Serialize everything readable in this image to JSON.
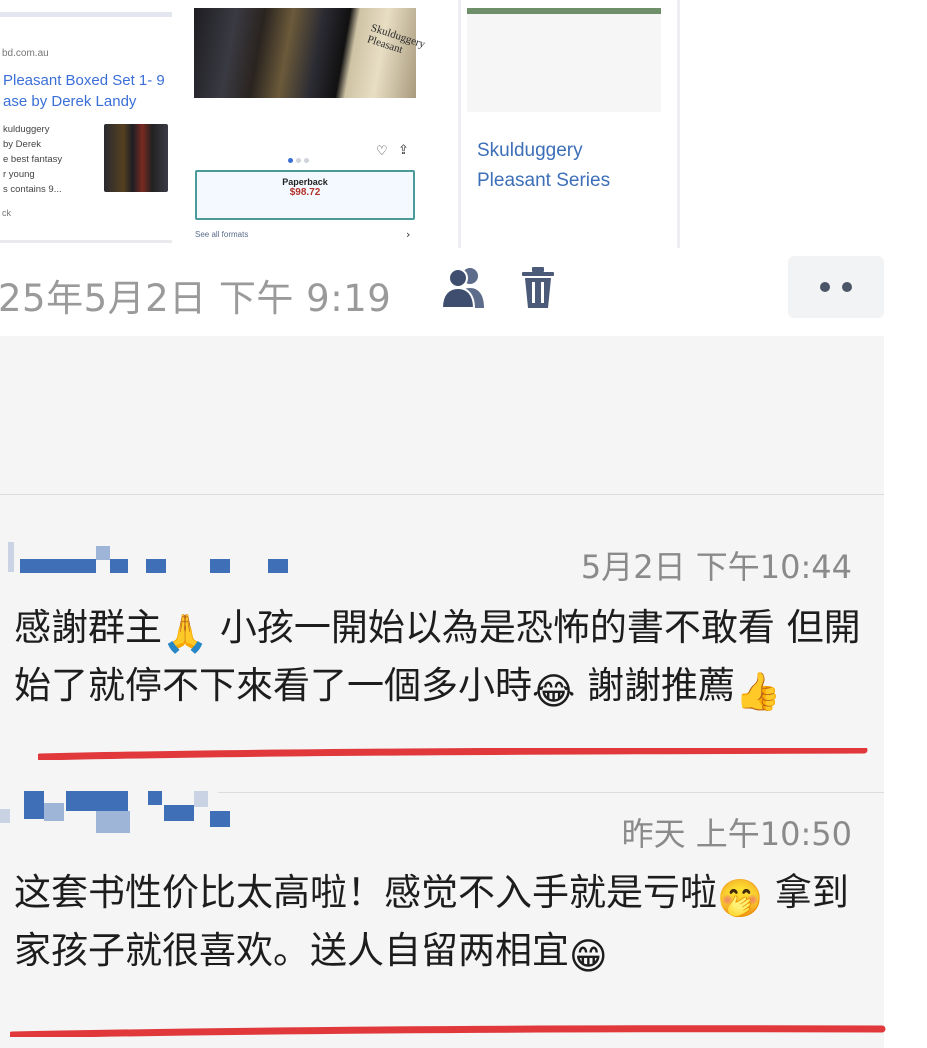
{
  "shared_cards": {
    "card1": {
      "domain": "bd.com.au",
      "title": "Pleasant Boxed Set 1- 9\nase by Derek Landy",
      "snippet": "kulduggery\nby Derek\ne best fantasy\nr young\ns contains 9...",
      "more": "ck"
    },
    "card2": {
      "cover_text": "Skulduggery Pleasant",
      "format_label": "Paperback",
      "format_price": "$98.72",
      "see_all": "See all formats"
    },
    "card3": {
      "title": "Skulduggery\nPleasant Series"
    }
  },
  "post": {
    "date": "25年5月2日 下午 9:19",
    "icons": [
      "group-icon",
      "trash-icon",
      "more-icon"
    ]
  },
  "comments": [
    {
      "time": "5月2日 下午10:44",
      "text_parts": [
        "感謝群主",
        "🙏",
        " 小孩一開始以為是恐怖的書不敢看 但開始了就停不下來看了一個多小時",
        "😂",
        " 謝謝推薦",
        "👍"
      ]
    },
    {
      "time": "昨天 上午10:50",
      "text_parts": [
        "这套书性价比太高啦！感觉不入手就是亏啦",
        "🤭",
        " 拿到家孩子就很喜欢。送人自留两相宜",
        "😁"
      ]
    }
  ],
  "colors": {
    "link_blue": "#3b6fd8",
    "timestamp_gray": "#8a8a8a",
    "underline_red": "#e0383b",
    "panel_bg": "#f5f5f5"
  }
}
